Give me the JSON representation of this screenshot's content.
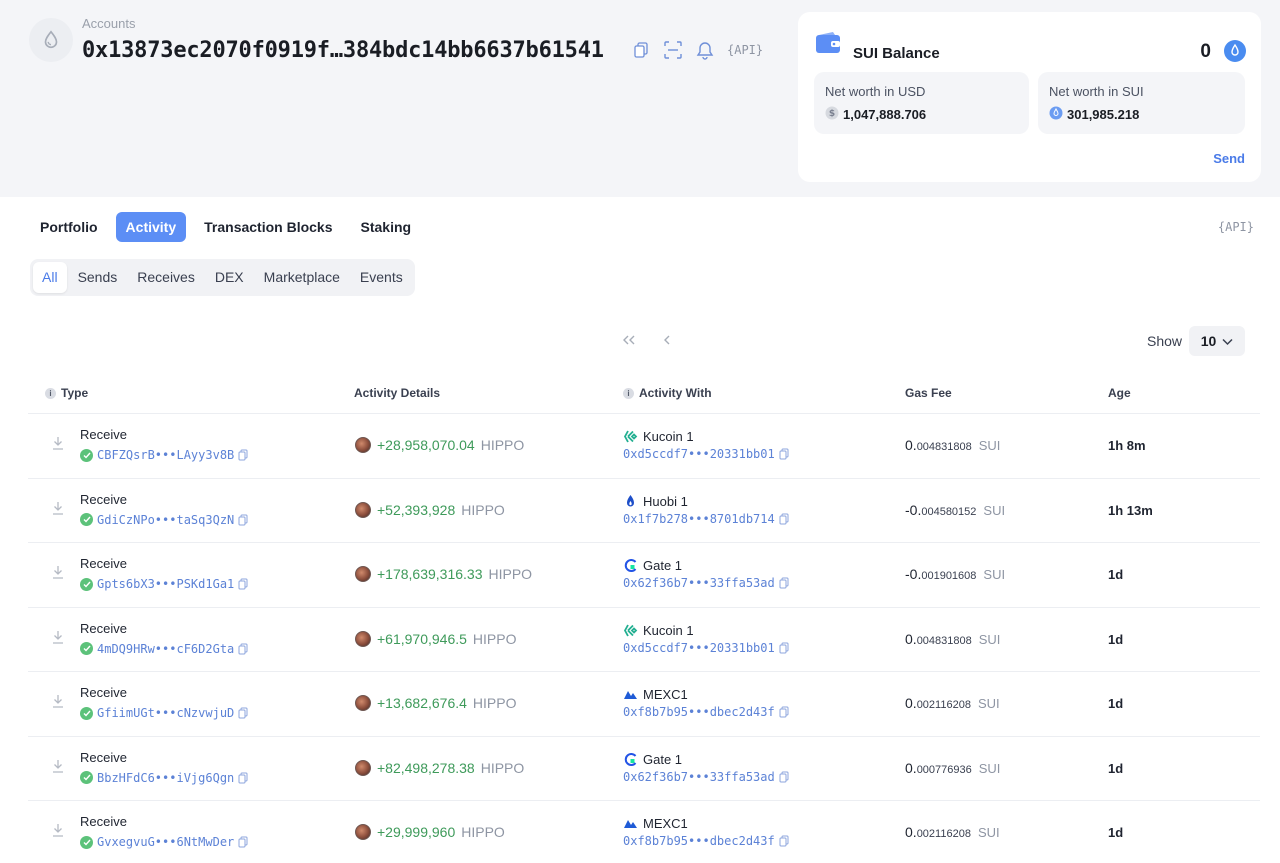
{
  "account": {
    "label": "Accounts",
    "address": "0x13873ec2070f0919f…384bdc14bb6637b61541",
    "api_label": "{API}"
  },
  "balance_card": {
    "title": "SUI Balance",
    "amount": "0",
    "net_worth_usd_label": "Net worth in USD",
    "net_worth_usd_value": "1,047,888.706",
    "net_worth_sui_label": "Net worth in SUI",
    "net_worth_sui_value": "301,985.218",
    "send_label": "Send"
  },
  "tabs": [
    "Portfolio",
    "Activity",
    "Transaction Blocks",
    "Staking"
  ],
  "active_tab": "Activity",
  "api_right_label": "{API}",
  "subtabs": [
    "All",
    "Sends",
    "Receives",
    "DEX",
    "Marketplace",
    "Events"
  ],
  "active_subtab": "All",
  "pagination": {
    "show_label": "Show",
    "page_size": "10"
  },
  "table": {
    "columns": {
      "type": "Type",
      "details": "Activity Details",
      "with": "Activity With",
      "gas": "Gas Fee",
      "age": "Age"
    },
    "rows": [
      {
        "type": "Receive",
        "digest": "CBFZQsrB•••LAyy3v8B",
        "amount": "+28,958,070.04",
        "token": "HIPPO",
        "exchange": "Kucoin 1",
        "exchange_icon": "kucoin-icon",
        "with_addr": "0xd5ccdf7•••20331bb01",
        "gas_int": "0.",
        "gas_frac": "004831808",
        "gas_unit": "SUI",
        "age": "1h 8m"
      },
      {
        "type": "Receive",
        "digest": "GdiCzNPo•••taSq3QzN",
        "amount": "+52,393,928",
        "token": "HIPPO",
        "exchange": "Huobi 1",
        "exchange_icon": "huobi-icon",
        "with_addr": "0x1f7b278•••8701db714",
        "gas_int": "-0.",
        "gas_frac": "004580152",
        "gas_unit": "SUI",
        "age": "1h 13m"
      },
      {
        "type": "Receive",
        "digest": "Gpts6bX3•••PSKd1Ga1",
        "amount": "+178,639,316.33",
        "token": "HIPPO",
        "exchange": "Gate 1",
        "exchange_icon": "gate-icon",
        "with_addr": "0x62f36b7•••33ffa53ad",
        "gas_int": "-0.",
        "gas_frac": "001901608",
        "gas_unit": "SUI",
        "age": "1d"
      },
      {
        "type": "Receive",
        "digest": "4mDQ9HRw•••cF6D2Gta",
        "amount": "+61,970,946.5",
        "token": "HIPPO",
        "exchange": "Kucoin 1",
        "exchange_icon": "kucoin-icon",
        "with_addr": "0xd5ccdf7•••20331bb01",
        "gas_int": "0.",
        "gas_frac": "004831808",
        "gas_unit": "SUI",
        "age": "1d"
      },
      {
        "type": "Receive",
        "digest": "GfiimUGt•••cNzvwjuD",
        "amount": "+13,682,676.4",
        "token": "HIPPO",
        "exchange": "MEXC1",
        "exchange_icon": "mexc-icon",
        "with_addr": "0xf8b7b95•••dbec2d43f",
        "gas_int": "0.",
        "gas_frac": "002116208",
        "gas_unit": "SUI",
        "age": "1d"
      },
      {
        "type": "Receive",
        "digest": "BbzHFdC6•••iVjg6Qgn",
        "amount": "+82,498,278.38",
        "token": "HIPPO",
        "exchange": "Gate 1",
        "exchange_icon": "gate-icon",
        "with_addr": "0x62f36b7•••33ffa53ad",
        "gas_int": "0.",
        "gas_frac": "000776936",
        "gas_unit": "SUI",
        "age": "1d"
      },
      {
        "type": "Receive",
        "digest": "GvxegvuG•••6NtMwDer",
        "amount": "+29,999,960",
        "token": "HIPPO",
        "exchange": "MEXC1",
        "exchange_icon": "mexc-icon",
        "with_addr": "0xf8b7b95•••dbec2d43f",
        "gas_int": "0.",
        "gas_frac": "002116208",
        "gas_unit": "SUI",
        "age": "1d"
      }
    ]
  },
  "colors": {
    "accent": "#5c8ef5",
    "link": "#5c82d6",
    "positive": "#3e9a5a",
    "success": "#5cc27a"
  }
}
